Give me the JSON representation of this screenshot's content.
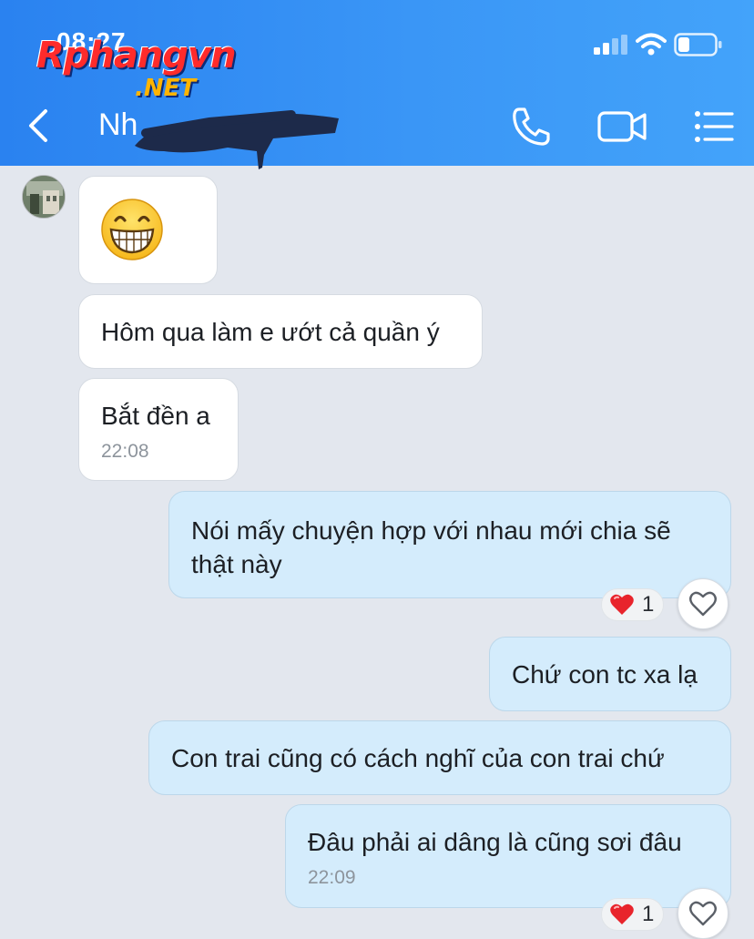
{
  "status_bar": {
    "time": "08:27"
  },
  "watermark": {
    "main": "Rphangvn",
    "sub": ".NET"
  },
  "header": {
    "contact_name": "Nh"
  },
  "messages": [
    {
      "text": "Hôm qua làm e ướt cả quần ý"
    },
    {
      "text": "Bắt đền a",
      "time": "22:08"
    },
    {
      "text_line1": "Nói mấy chuyện hợp với nhau mới chia sẽ",
      "text_line2": "thật này",
      "reaction_count": "1"
    },
    {
      "text": "Chứ con tc xa lạ"
    },
    {
      "text": "Con trai cũng có cách nghĩ của con trai chứ"
    },
    {
      "text": "Đâu phải ai dâng là cũng sơi đâu",
      "time": "22:09",
      "reaction_count": "1"
    }
  ],
  "colors": {
    "header_gradient_start": "#2a82f0",
    "header_gradient_end": "#43a3fa",
    "chat_background": "#e3e7ee",
    "incoming_bubble": "#ffffff",
    "outgoing_bubble": "#d4ecfc",
    "reaction_heart": "#e8242c"
  },
  "icons": [
    "signal-icon",
    "wifi-icon",
    "battery-icon",
    "back-chevron-icon",
    "phone-icon",
    "video-camera-icon",
    "menu-list-icon",
    "grinning-emoji",
    "heart-reaction-icon",
    "heart-outline-icon"
  ]
}
